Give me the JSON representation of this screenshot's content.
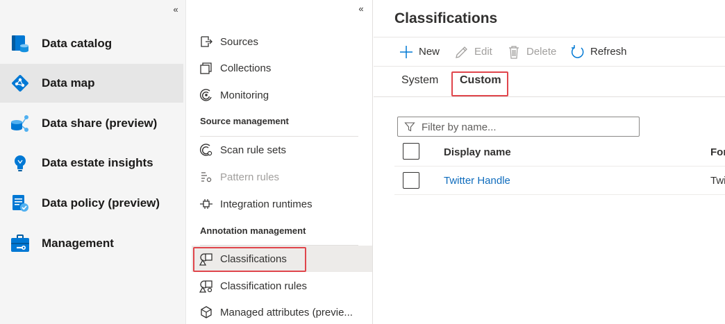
{
  "left_nav": {
    "collapse_glyph": "«",
    "items": [
      {
        "label": "Data catalog",
        "icon": "data-catalog-icon"
      },
      {
        "label": "Data map",
        "icon": "data-map-icon",
        "selected": true
      },
      {
        "label": "Data share (preview)",
        "icon": "data-share-icon"
      },
      {
        "label": "Data estate insights",
        "icon": "insights-lightbulb-icon"
      },
      {
        "label": "Data policy (preview)",
        "icon": "data-policy-icon"
      },
      {
        "label": "Management",
        "icon": "management-toolbox-icon"
      }
    ]
  },
  "mid_nav": {
    "collapse_glyph": "«",
    "items_top": [
      {
        "label": "Sources",
        "icon": "sources-icon"
      },
      {
        "label": "Collections",
        "icon": "collections-icon"
      },
      {
        "label": "Monitoring",
        "icon": "monitoring-icon"
      }
    ],
    "source_management_header": "Source management",
    "source_items": [
      {
        "label": "Scan rule sets",
        "icon": "scan-rule-sets-icon"
      },
      {
        "label": "Pattern rules",
        "icon": "pattern-rules-icon",
        "disabled": true
      },
      {
        "label": "Integration runtimes",
        "icon": "integration-runtimes-icon"
      }
    ],
    "annotation_management_header": "Annotation management",
    "annotation_items": [
      {
        "label": "Classifications",
        "icon": "classifications-icon",
        "selected": true
      },
      {
        "label": "Classification rules",
        "icon": "classification-rules-icon"
      },
      {
        "label": "Managed attributes (previe...",
        "icon": "managed-attributes-icon"
      }
    ]
  },
  "main": {
    "title": "Classifications",
    "toolbar": {
      "new_label": "New",
      "edit_label": "Edit",
      "delete_label": "Delete",
      "refresh_label": "Refresh"
    },
    "tabs": {
      "system_label": "System",
      "custom_label": "Custom",
      "active": "Custom"
    },
    "filter": {
      "placeholder": "Filter by name..."
    },
    "table": {
      "col_display_name": "Display name",
      "col_formal": "For",
      "rows": [
        {
          "display_name": "Twitter Handle",
          "formal": "Twi"
        }
      ]
    }
  },
  "colors": {
    "accent": "#0078d4",
    "link": "#0f6cbd",
    "highlight_box": "#e0454b",
    "selected_bg": "#e6e6e6"
  }
}
